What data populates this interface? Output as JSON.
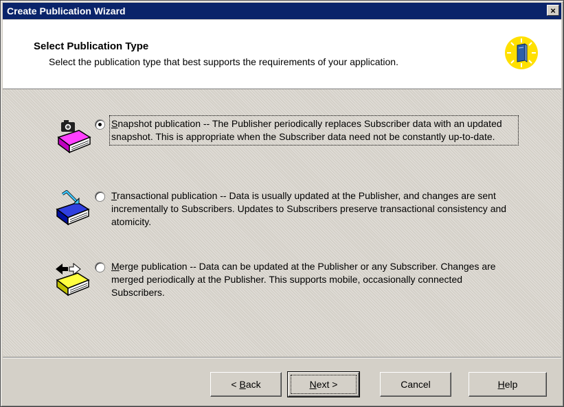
{
  "window": {
    "title": "Create Publication Wizard",
    "close_label": "×"
  },
  "header": {
    "title": "Select Publication Type",
    "subtitle": "Select the publication type that best supports the requirements of your application."
  },
  "options": [
    {
      "accel": "S",
      "rest": "napshot publication -- The Publisher periodically replaces Subscriber data with an updated snapshot. This is appropriate when the Subscriber data need not be constantly up-to-date.",
      "selected": true,
      "icon": "snapshot-book-icon"
    },
    {
      "accel": "T",
      "rest": "ransactional publication -- Data is usually updated at the Publisher, and changes are sent incrementally to Subscribers. Updates to Subscribers preserve transactional consistency and atomicity.",
      "selected": false,
      "icon": "transactional-book-icon"
    },
    {
      "accel": "M",
      "rest": "erge publication -- Data can be updated at the Publisher or any Subscriber. Changes are merged periodically at the Publisher. This supports mobile, occasionally connected Subscribers.",
      "selected": false,
      "icon": "merge-book-icon"
    }
  ],
  "buttons": {
    "back": {
      "pre": "< ",
      "accel": "B",
      "rest": "ack"
    },
    "next": {
      "pre": "",
      "accel": "N",
      "rest": "ext >"
    },
    "cancel": {
      "label": "Cancel"
    },
    "help": {
      "pre": "",
      "accel": "H",
      "rest": "elp"
    }
  },
  "colors": {
    "titlebar": "#0a246a",
    "dialog": "#d4d0c8",
    "header_icon": "#ffe000"
  }
}
